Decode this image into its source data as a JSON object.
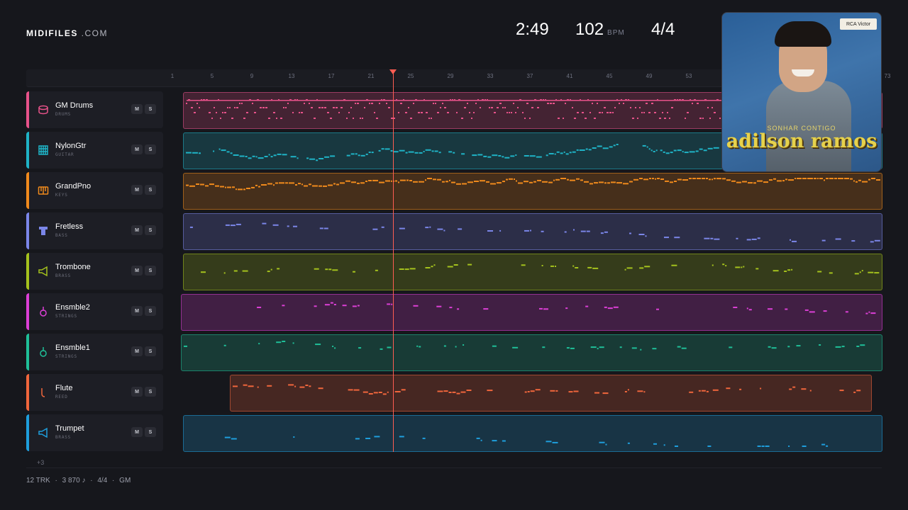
{
  "brand": {
    "bold": "MIDIFILES",
    "rest": " .COM"
  },
  "hud": {
    "time": "2:49",
    "bpm": "102",
    "bpm_unit": "BPM",
    "signature": "4/4"
  },
  "ruler": {
    "bars": [
      "1",
      "5",
      "9",
      "13",
      "17",
      "21",
      "25",
      "29",
      "33",
      "37",
      "41",
      "45",
      "49",
      "53",
      "73"
    ]
  },
  "playback": {
    "playhead_bar": 23.2,
    "total_bars": 73
  },
  "tracks": [
    {
      "name": "GM Drums",
      "category": "DRUMS",
      "icon": "drum-icon",
      "color": "#e8528a",
      "mute": "M",
      "solo": "S"
    },
    {
      "name": "NylonGtr",
      "category": "GUITAR",
      "icon": "guitar-icon",
      "color": "#1fb3c6",
      "mute": "M",
      "solo": "S"
    },
    {
      "name": "GrandPno",
      "category": "KEYS",
      "icon": "piano-icon",
      "color": "#f08a1c",
      "mute": "M",
      "solo": "S"
    },
    {
      "name": "Fretless",
      "category": "BASS",
      "icon": "bass-icon",
      "color": "#7b86e8",
      "mute": "M",
      "solo": "S"
    },
    {
      "name": "Trombone",
      "category": "BRASS",
      "icon": "horn-icon",
      "color": "#a5c21d",
      "mute": "M",
      "solo": "S"
    },
    {
      "name": "Ensmble2",
      "category": "STRINGS",
      "icon": "violin-icon",
      "color": "#dc3fd6",
      "mute": "M",
      "solo": "S"
    },
    {
      "name": "Ensmble1",
      "category": "STRINGS",
      "icon": "violin-icon",
      "color": "#1fbf98",
      "mute": "M",
      "solo": "S"
    },
    {
      "name": "Flute",
      "category": "REED",
      "icon": "flute-icon",
      "color": "#f0663c",
      "mute": "M",
      "solo": "S"
    },
    {
      "name": "Trumpet",
      "category": "BRASS",
      "icon": "horn-icon",
      "color": "#1e9edc",
      "mute": "M",
      "solo": "S"
    }
  ],
  "more_tracks": "+3",
  "footer": {
    "tracks": "12 TRK",
    "notes": "3 870 ♪",
    "signature": "4/4",
    "standard": "GM",
    "sep": "·"
  },
  "album": {
    "record_label": "RCA Victor",
    "subtitle": "SONHAR CONTIGO",
    "artist": "adilson ramos"
  }
}
